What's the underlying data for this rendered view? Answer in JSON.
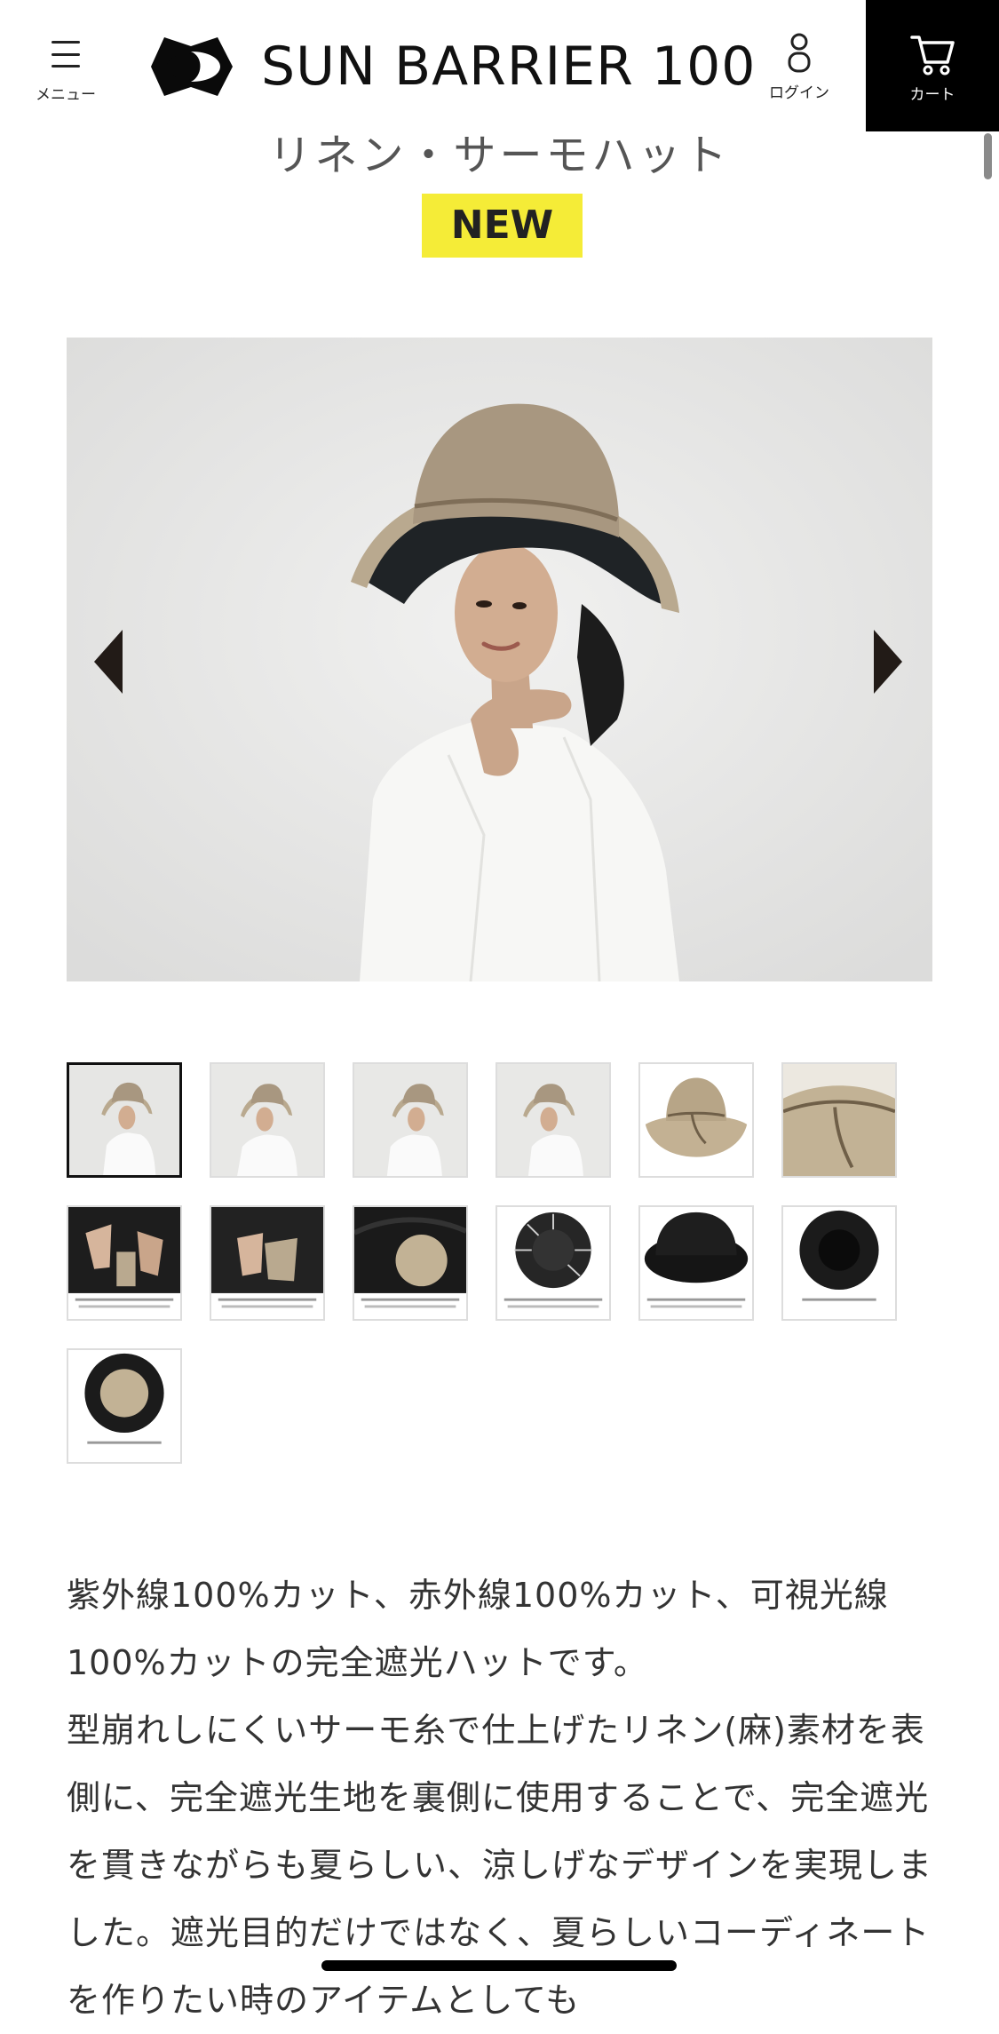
{
  "header": {
    "menu_label": "メニュー",
    "logo_text": "SUN BARRIER 100",
    "login_label": "ログイン",
    "cart_label": "カート"
  },
  "product": {
    "title": "リネン・サーモハット",
    "badge": "NEW"
  },
  "gallery": {
    "thumbnail_count": 13,
    "active_index": 0
  },
  "description": {
    "paragraph_1": "紫外線100%カット、赤外線100%カット、可視光線100%カットの完全遮光ハットです。",
    "paragraph_2": "型崩れしにくいサーモ糸で仕上げたリネン(麻)素材を表側に、完全遮光生地を裏側に使用することで、完全遮光を貫きながらも夏らしい、涼しげなデザインを実現しました。遮光目的だけではなく、夏らしいコーディネートを作りたい時のアイテムとしても"
  },
  "colors": {
    "badge_yellow": "#f5ec37",
    "cart_background": "#000000",
    "hat_beige": "#b9a98f"
  }
}
